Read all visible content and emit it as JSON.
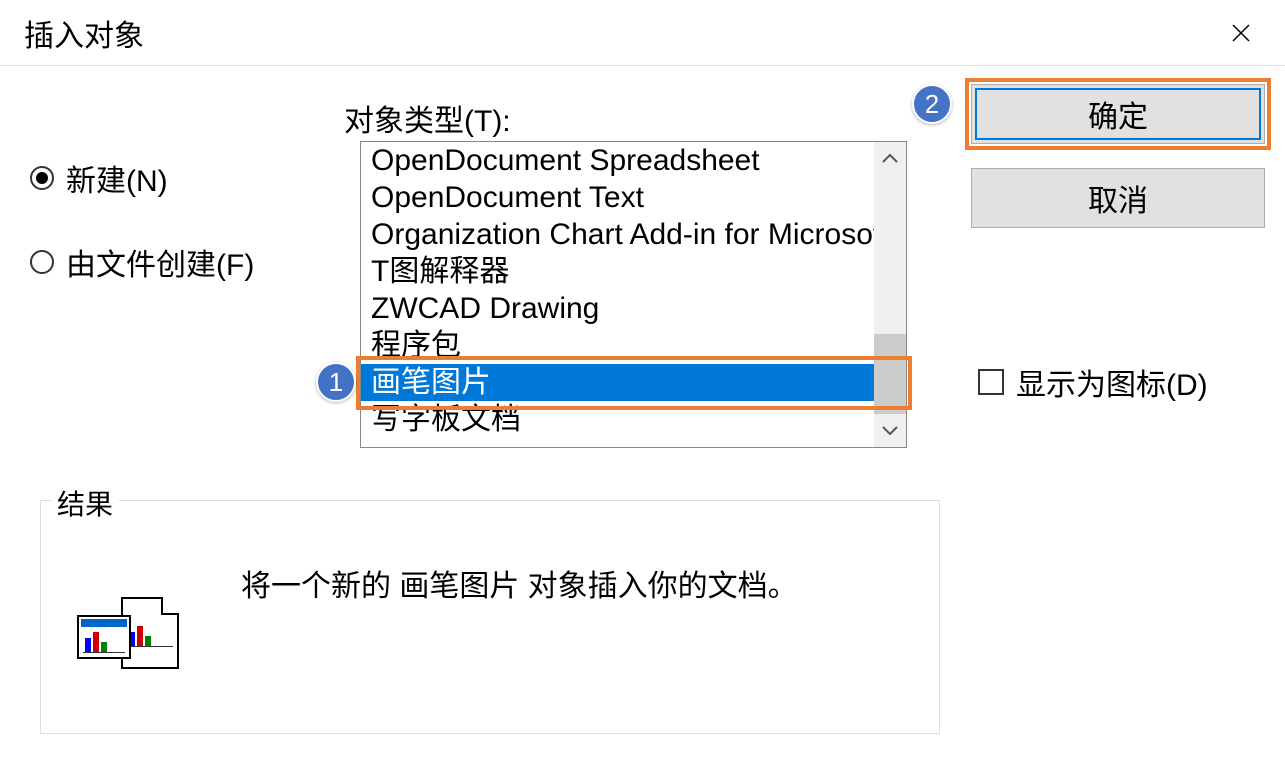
{
  "dialog": {
    "title": "插入对象",
    "close_aria": "关闭"
  },
  "radios": {
    "new_label": "新建(N)",
    "from_file_label": "由文件创建(F)",
    "selected": "new"
  },
  "listbox": {
    "label": "对象类型(T):",
    "items": [
      "OpenDocument Spreadsheet",
      "OpenDocument Text",
      "Organization Chart Add-in for Microsof",
      "T图解释器",
      "ZWCAD Drawing",
      "程序包",
      "画笔图片",
      "写字板文档"
    ],
    "selected_index": 6
  },
  "buttons": {
    "ok_label": "确定",
    "cancel_label": "取消"
  },
  "checkbox": {
    "display_as_icon_label": "显示为图标(D)",
    "checked": false
  },
  "result_group": {
    "legend": "结果",
    "description": "将一个新的 画笔图片 对象插入你的文档。"
  },
  "annotations": {
    "badge1": "1",
    "badge2": "2"
  },
  "icons": {
    "close": "close-icon",
    "scroll_up": "chevron-up-icon",
    "scroll_down": "chevron-down-icon",
    "result_preview": "object-embed-icon"
  }
}
